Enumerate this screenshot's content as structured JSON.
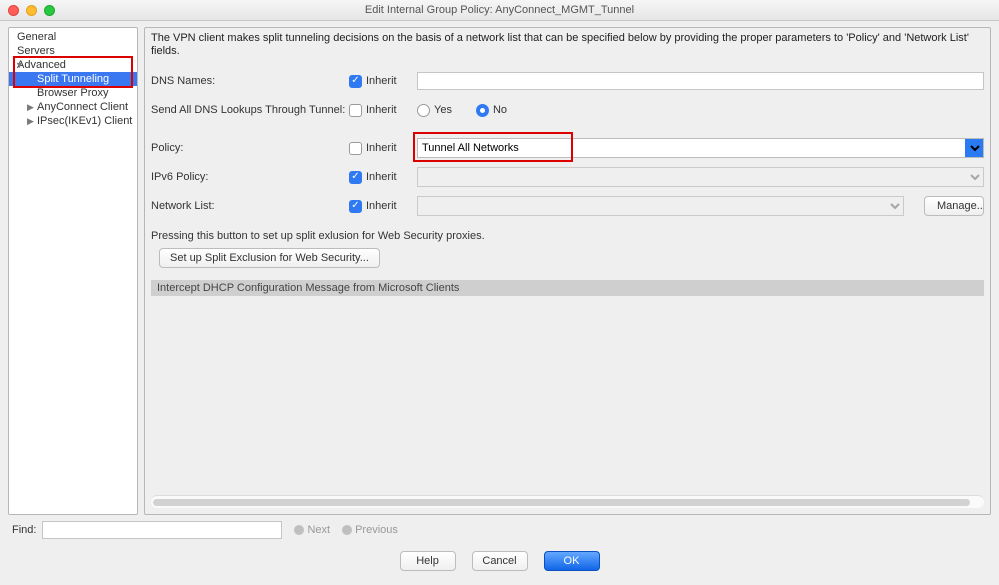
{
  "window": {
    "title": "Edit Internal Group Policy: AnyConnect_MGMT_Tunnel"
  },
  "sidebar": {
    "items": [
      {
        "label": "General",
        "expandable": false
      },
      {
        "label": "Servers",
        "expandable": false
      },
      {
        "label": "Advanced",
        "expandable": true,
        "expanded": true,
        "children": [
          {
            "label": "Split Tunneling",
            "selected": true
          },
          {
            "label": "Browser Proxy",
            "selected": false
          },
          {
            "label": "AnyConnect Client",
            "selected": false,
            "expandable": true
          },
          {
            "label": "IPsec(IKEv1) Client",
            "selected": false,
            "expandable": true
          }
        ]
      }
    ]
  },
  "panel": {
    "description": "The VPN client makes split tunneling decisions on the basis of a network list that can be specified below by providing the proper parameters to 'Policy' and 'Network List' fields.",
    "dns_names": {
      "label": "DNS Names:",
      "inherit": true,
      "inherit_label": "Inherit",
      "value": ""
    },
    "send_all_dns": {
      "label": "Send All DNS Lookups Through Tunnel:",
      "inherit": false,
      "inherit_label": "Inherit",
      "yes_label": "Yes",
      "no_label": "No",
      "value": "No"
    },
    "policy": {
      "label": "Policy:",
      "inherit": false,
      "inherit_label": "Inherit",
      "selected": "Tunnel All Networks"
    },
    "ipv6_policy": {
      "label": "IPv6 Policy:",
      "inherit": true,
      "inherit_label": "Inherit",
      "selected": ""
    },
    "network_list": {
      "label": "Network List:",
      "inherit": true,
      "inherit_label": "Inherit",
      "selected": "",
      "manage_label": "Manage..."
    },
    "web_security": {
      "hint": "Pressing this button to set up split exlusion for Web Security proxies.",
      "button": "Set up Split Exclusion for Web Security..."
    },
    "dhcp_section": "Intercept DHCP Configuration Message from Microsoft Clients"
  },
  "find": {
    "label": "Find:",
    "value": "",
    "next": "Next",
    "previous": "Previous"
  },
  "buttons": {
    "help": "Help",
    "cancel": "Cancel",
    "ok": "OK"
  }
}
